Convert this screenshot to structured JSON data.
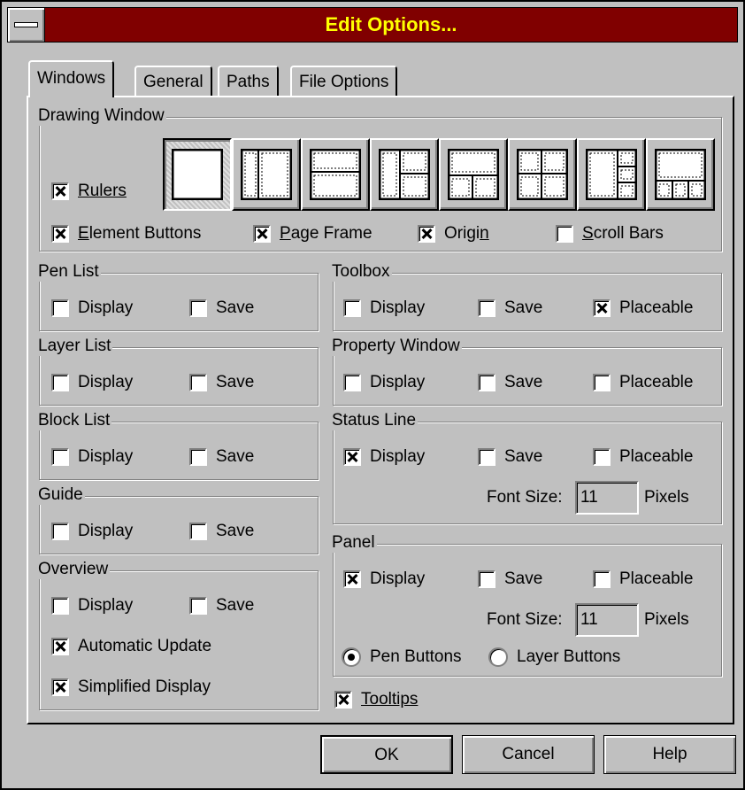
{
  "window": {
    "title": "Edit Options..."
  },
  "tabs": [
    "Windows",
    "General",
    "Paths",
    "File Options"
  ],
  "drawing_window": {
    "label": "Drawing Window",
    "rulers": {
      "label": "Rulers",
      "checked": true
    },
    "element_buttons": {
      "label": "Element Buttons",
      "checked": true
    },
    "page_frame": {
      "label": "Page Frame",
      "checked": true
    },
    "origin": {
      "label": "Origin",
      "checked": true
    },
    "scroll_bars": {
      "label": "Scroll Bars",
      "checked": false
    },
    "layouts": [
      "single",
      "split-vertical",
      "split-horizontal",
      "three-right",
      "three-bottom",
      "quad",
      "four-right",
      "four-bottom"
    ],
    "selected_layout": 0
  },
  "pen_list": {
    "label": "Pen List",
    "display": "Display",
    "save": "Save"
  },
  "layer_list": {
    "label": "Layer List",
    "display": "Display",
    "save": "Save"
  },
  "block_list": {
    "label": "Block List",
    "display": "Display",
    "save": "Save"
  },
  "guide": {
    "label": "Guide",
    "display": "Display",
    "save": "Save"
  },
  "overview": {
    "label": "Overview",
    "display": "Display",
    "save": "Save",
    "automatic_update": "Automatic Update",
    "simplified_display": "Simplified Display"
  },
  "toolbox": {
    "label": "Toolbox",
    "display": "Display",
    "save": "Save",
    "placeable": "Placeable"
  },
  "property_window": {
    "label": "Property Window",
    "display": "Display",
    "save": "Save",
    "placeable": "Placeable"
  },
  "status_line": {
    "label": "Status Line",
    "display": "Display",
    "save": "Save",
    "placeable": "Placeable",
    "font_size_label": "Font Size:",
    "font_size_value": "11",
    "units": "Pixels"
  },
  "panel": {
    "label": "Panel",
    "display": "Display",
    "save": "Save",
    "placeable": "Placeable",
    "font_size_label": "Font Size:",
    "font_size_value": "11",
    "units": "Pixels",
    "pen_buttons": "Pen Buttons",
    "layer_buttons": "Layer Buttons"
  },
  "tooltips": {
    "label": "Tooltips",
    "checked": true
  },
  "buttons": {
    "ok": "OK",
    "cancel": "Cancel",
    "help": "Help"
  }
}
